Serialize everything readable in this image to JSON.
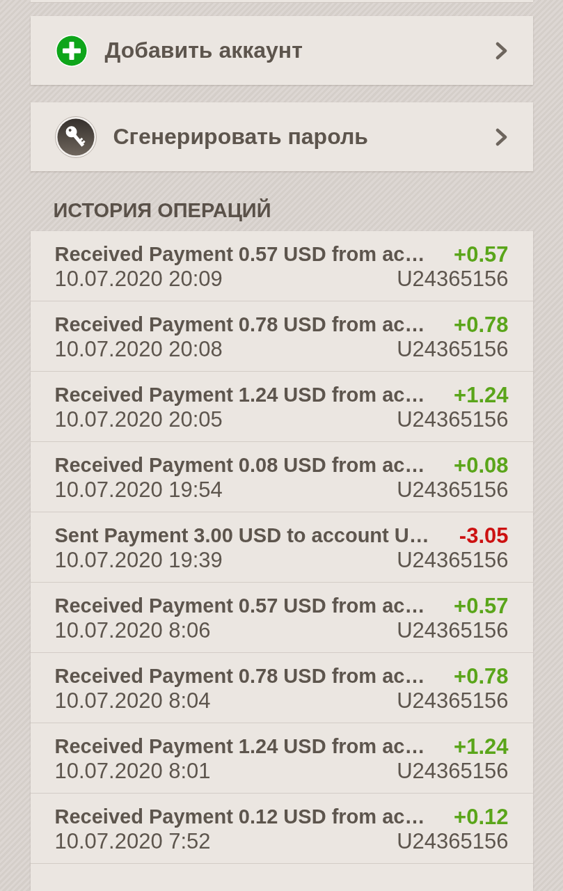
{
  "menu": [
    {
      "kind": "add",
      "label": "Добавить аккаунт"
    },
    {
      "kind": "key",
      "label": "Сгенерировать пароль"
    }
  ],
  "history": {
    "title": "ИСТОРИЯ ОПЕРАЦИЙ",
    "rows": [
      {
        "kind": "credit",
        "description": "Received Payment 0.57 USD from ac…",
        "amount": "+0.57",
        "date": "10.07.2020 20:09",
        "account": "U24365156"
      },
      {
        "kind": "credit",
        "description": "Received Payment 0.78 USD from ac…",
        "amount": "+0.78",
        "date": "10.07.2020 20:08",
        "account": "U24365156"
      },
      {
        "kind": "credit",
        "description": "Received Payment 1.24 USD from ac…",
        "amount": "+1.24",
        "date": "10.07.2020 20:05",
        "account": "U24365156"
      },
      {
        "kind": "credit",
        "description": "Received Payment 0.08 USD from ac…",
        "amount": "+0.08",
        "date": "10.07.2020 19:54",
        "account": "U24365156"
      },
      {
        "kind": "debit",
        "description": "Sent Payment 3.00 USD to account U…",
        "amount": "-3.05",
        "date": "10.07.2020 19:39",
        "account": "U24365156"
      },
      {
        "kind": "credit",
        "description": "Received Payment 0.57 USD from ac…",
        "amount": "+0.57",
        "date": "10.07.2020 8:06",
        "account": "U24365156"
      },
      {
        "kind": "credit",
        "description": "Received Payment 0.78 USD from ac…",
        "amount": "+0.78",
        "date": "10.07.2020 8:04",
        "account": "U24365156"
      },
      {
        "kind": "credit",
        "description": "Received Payment 1.24 USD from ac…",
        "amount": "+1.24",
        "date": "10.07.2020 8:01",
        "account": "U24365156"
      },
      {
        "kind": "credit",
        "description": "Received Payment 0.12 USD from ac…",
        "amount": "+0.12",
        "date": "10.07.2020 7:52",
        "account": "U24365156"
      }
    ]
  }
}
